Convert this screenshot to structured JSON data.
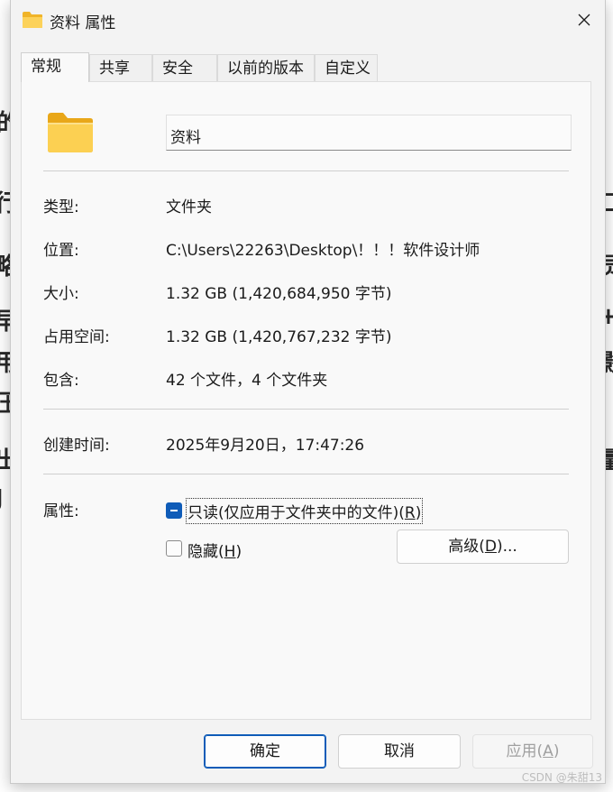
{
  "background_text": [
    "的",
    "行",
    "略",
    "早",
    "用",
    "压",
    "出",
    "J",
    "口",
    "员",
    "+",
    "影",
    "量"
  ],
  "window": {
    "title": "资料 属性",
    "close_glyph": "✕"
  },
  "tabs": [
    {
      "label": "常规",
      "active": true
    },
    {
      "label": "共享",
      "active": false
    },
    {
      "label": "安全",
      "active": false
    },
    {
      "label": "以前的版本",
      "active": false
    },
    {
      "label": "自定义",
      "active": false
    }
  ],
  "general": {
    "folder_name": "资料",
    "type_label": "类型:",
    "type_value": "文件夹",
    "location_label": "位置:",
    "location_value": "C:\\Users\\22263\\Desktop\\！！！软件设计师",
    "size_label": "大小:",
    "size_value": "1.32 GB (1,420,684,950 字节)",
    "disk_size_label": "占用空间:",
    "disk_size_value": "1.32 GB (1,420,767,232 字节)",
    "contains_label": "包含:",
    "contains_value": "42 个文件，4 个文件夹",
    "created_label": "创建时间:",
    "created_value": "2025年9月20日，17:47:26",
    "attributes_label": "属性:",
    "readonly_label_main": "只读(仅应用于文件夹中的文件)(",
    "readonly_key": "R",
    "readonly_label_end": ")",
    "readonly_state": "indeterminate",
    "hidden_label_main": "隐藏(",
    "hidden_key": "H",
    "hidden_label_end": ")",
    "hidden_state": "unchecked",
    "advanced_main": "高级(",
    "advanced_key": "D",
    "advanced_end": ")..."
  },
  "footer": {
    "ok_label": "确定",
    "cancel_label": "取消",
    "apply_main": "应用(",
    "apply_key": "A",
    "apply_end": ")"
  },
  "watermark": "CSDN @朱甜13",
  "colors": {
    "accent": "#0f5cb8",
    "folder_yellow": "#f8c33f",
    "window_bg": "#f3f3f3"
  },
  "icons": {
    "title_icon": "folder-icon",
    "close_icon": "close-icon",
    "large_icon": "folder-icon"
  }
}
